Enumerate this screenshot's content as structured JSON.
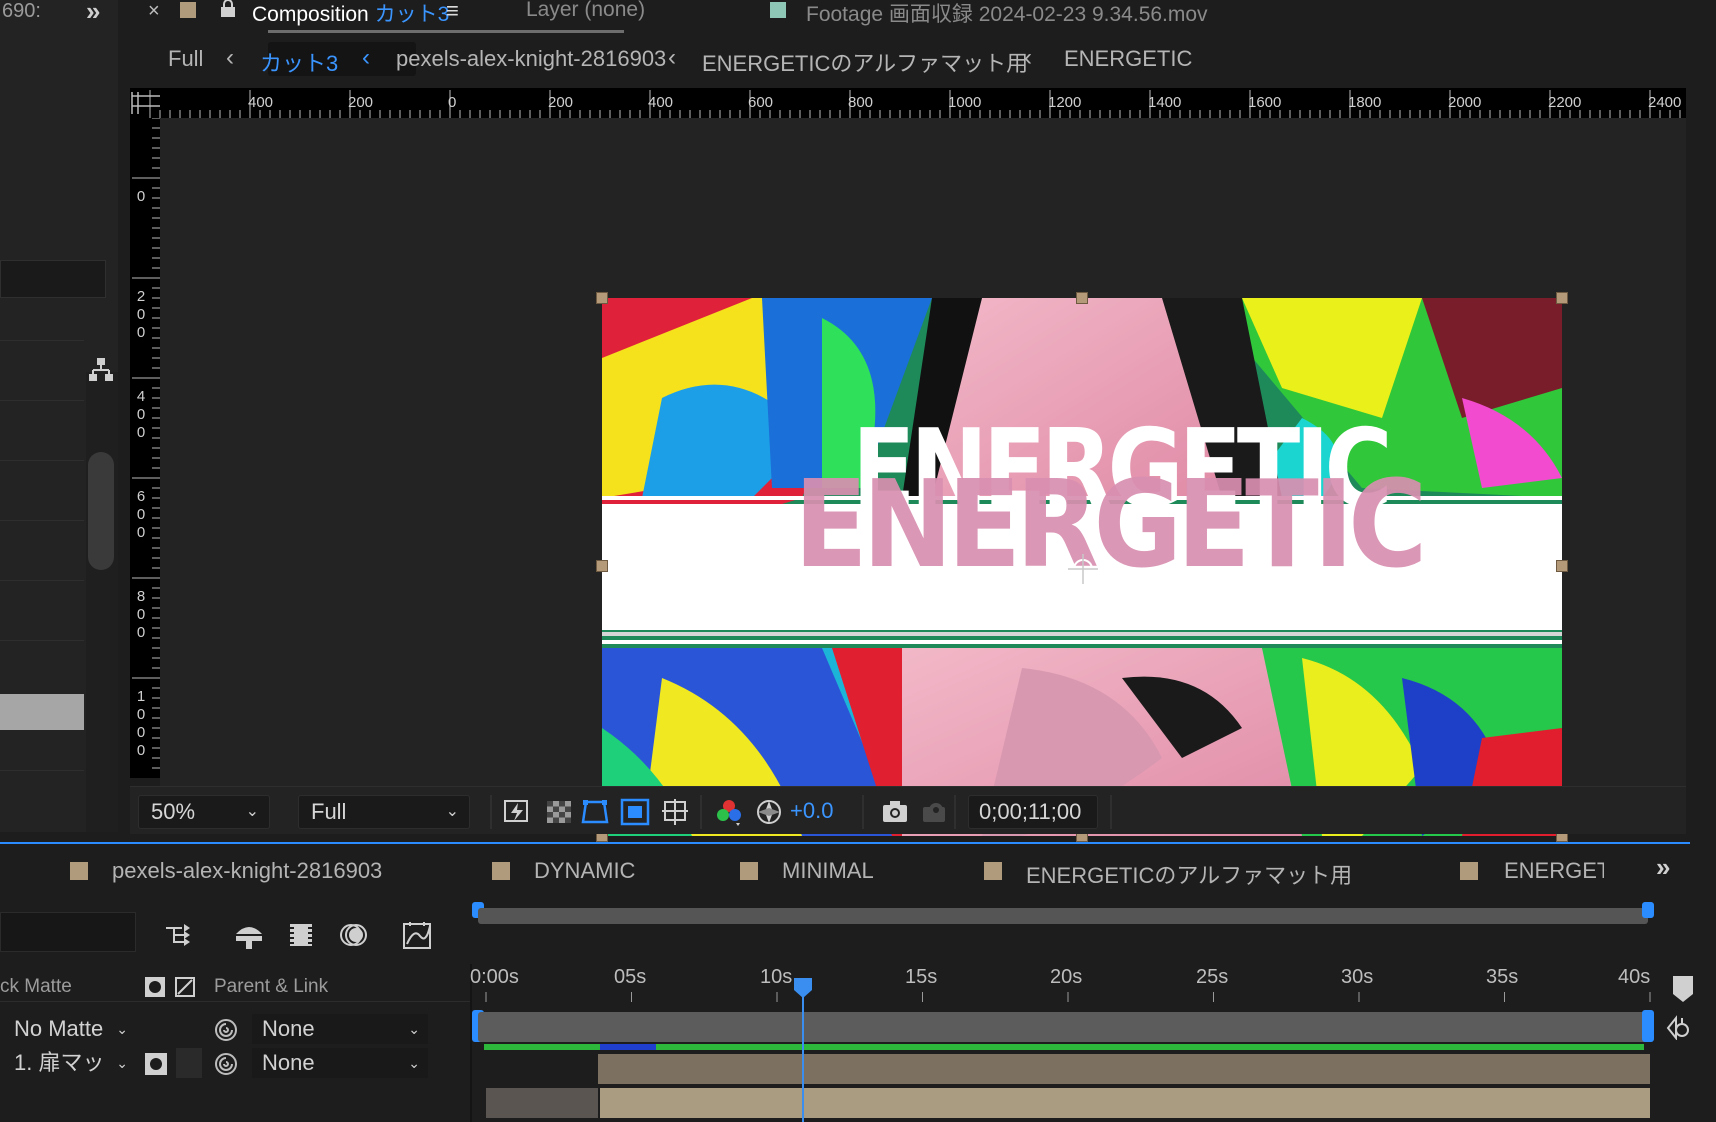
{
  "left_panel": {
    "number_fragment": "690:",
    "expand_label": "»"
  },
  "tabs": {
    "close_label": "×",
    "composition_prefix": "Composition",
    "composition_name": "カット3",
    "menu_label": "≡",
    "layer_label": "Layer (none)",
    "footage_label": "Footage 画面収録 2024-02-23 9.34.56.mov"
  },
  "breadcrumbs": {
    "items": [
      "Full",
      "カット3",
      "pexels-alex-knight-2816903",
      "ENERGETICのアルファマット用",
      "ENERGETIC"
    ],
    "separator": "‹"
  },
  "rulers": {
    "horizontal_labels": [
      "400",
      "200",
      "0",
      "200",
      "400",
      "600",
      "800",
      "1000",
      "1200",
      "1400",
      "1600",
      "1800",
      "2000",
      "2200",
      "2400"
    ],
    "vertical_labels": [
      "0",
      "200",
      "400",
      "600",
      "800",
      "1000"
    ]
  },
  "canvas": {
    "title_text": "ENERGETIC"
  },
  "viewer_toolbar": {
    "zoom": "50%",
    "resolution": "Full",
    "exposure": "+0.0",
    "timecode": "0;00;11;00"
  },
  "timeline": {
    "tabs": [
      "pexels-alex-knight-2816903",
      "DYNAMIC",
      "MINIMAL",
      "ENERGETICのアルファマット用",
      "ENERGETI"
    ],
    "overflow_label": "»",
    "header": {
      "track_matte": "ck Matte",
      "parent_link": "Parent & Link"
    },
    "rows": [
      {
        "matte": "No Matte",
        "parent": "None"
      },
      {
        "matte": "1. 扉マッ",
        "parent": "None"
      }
    ],
    "time_labels": [
      "0:00s",
      "05s",
      "10s",
      "15s",
      "20s",
      "25s",
      "30s",
      "35s",
      "40s"
    ]
  },
  "colors": {
    "accent_blue": "#2a8cff",
    "layer_tan": "#a99c80",
    "label_swatch": "#b09c7c",
    "footage_swatch": "#8fc7b7"
  }
}
